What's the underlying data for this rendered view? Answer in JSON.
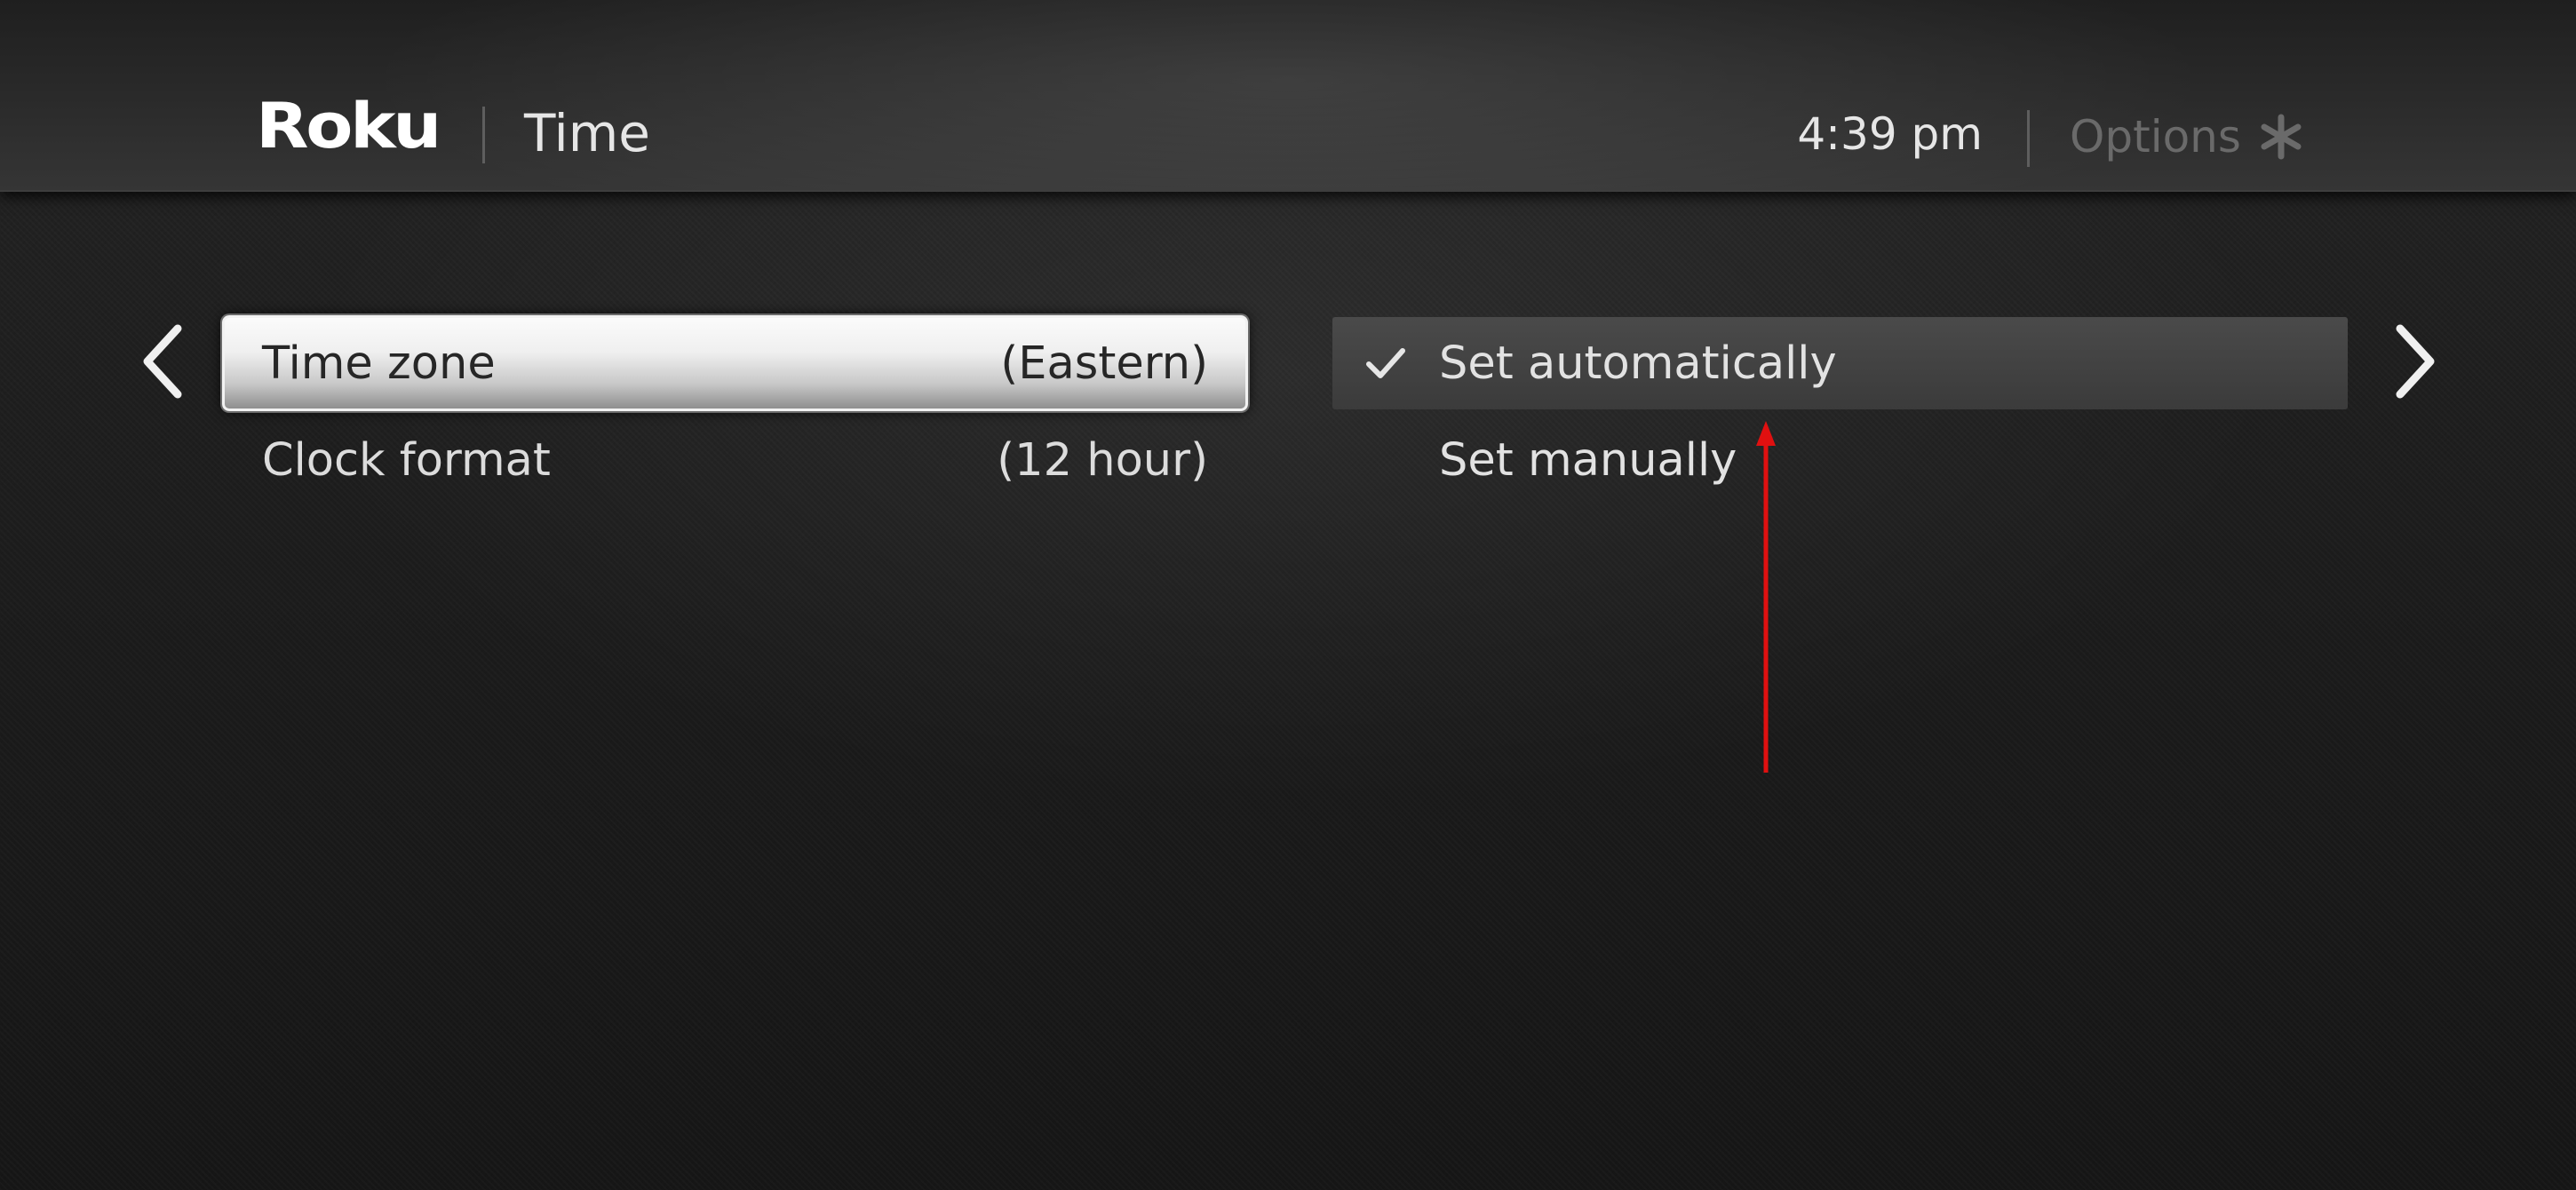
{
  "header": {
    "logo_text": "Roku",
    "title": "Time",
    "clock": "4:39 pm",
    "options_label": "Options",
    "options_icon": "asterisk-icon"
  },
  "navigation": {
    "prev_icon": "chevron-left-icon",
    "next_icon": "chevron-right-icon"
  },
  "settings_list": [
    {
      "label": "Time zone",
      "value": "(Eastern)",
      "selected": true
    },
    {
      "label": "Clock format",
      "value": "(12 hour)",
      "selected": false
    }
  ],
  "options_list": [
    {
      "label": "Set automatically",
      "checked": true,
      "highlighted": true
    },
    {
      "label": "Set manually",
      "checked": false,
      "highlighted": false
    }
  ],
  "colors": {
    "background": "#1c1c1c",
    "text_primary": "#e2e2e2",
    "text_dim": "#6a6a6a",
    "selected_text": "#262626",
    "annotation_arrow": "#e01010"
  }
}
